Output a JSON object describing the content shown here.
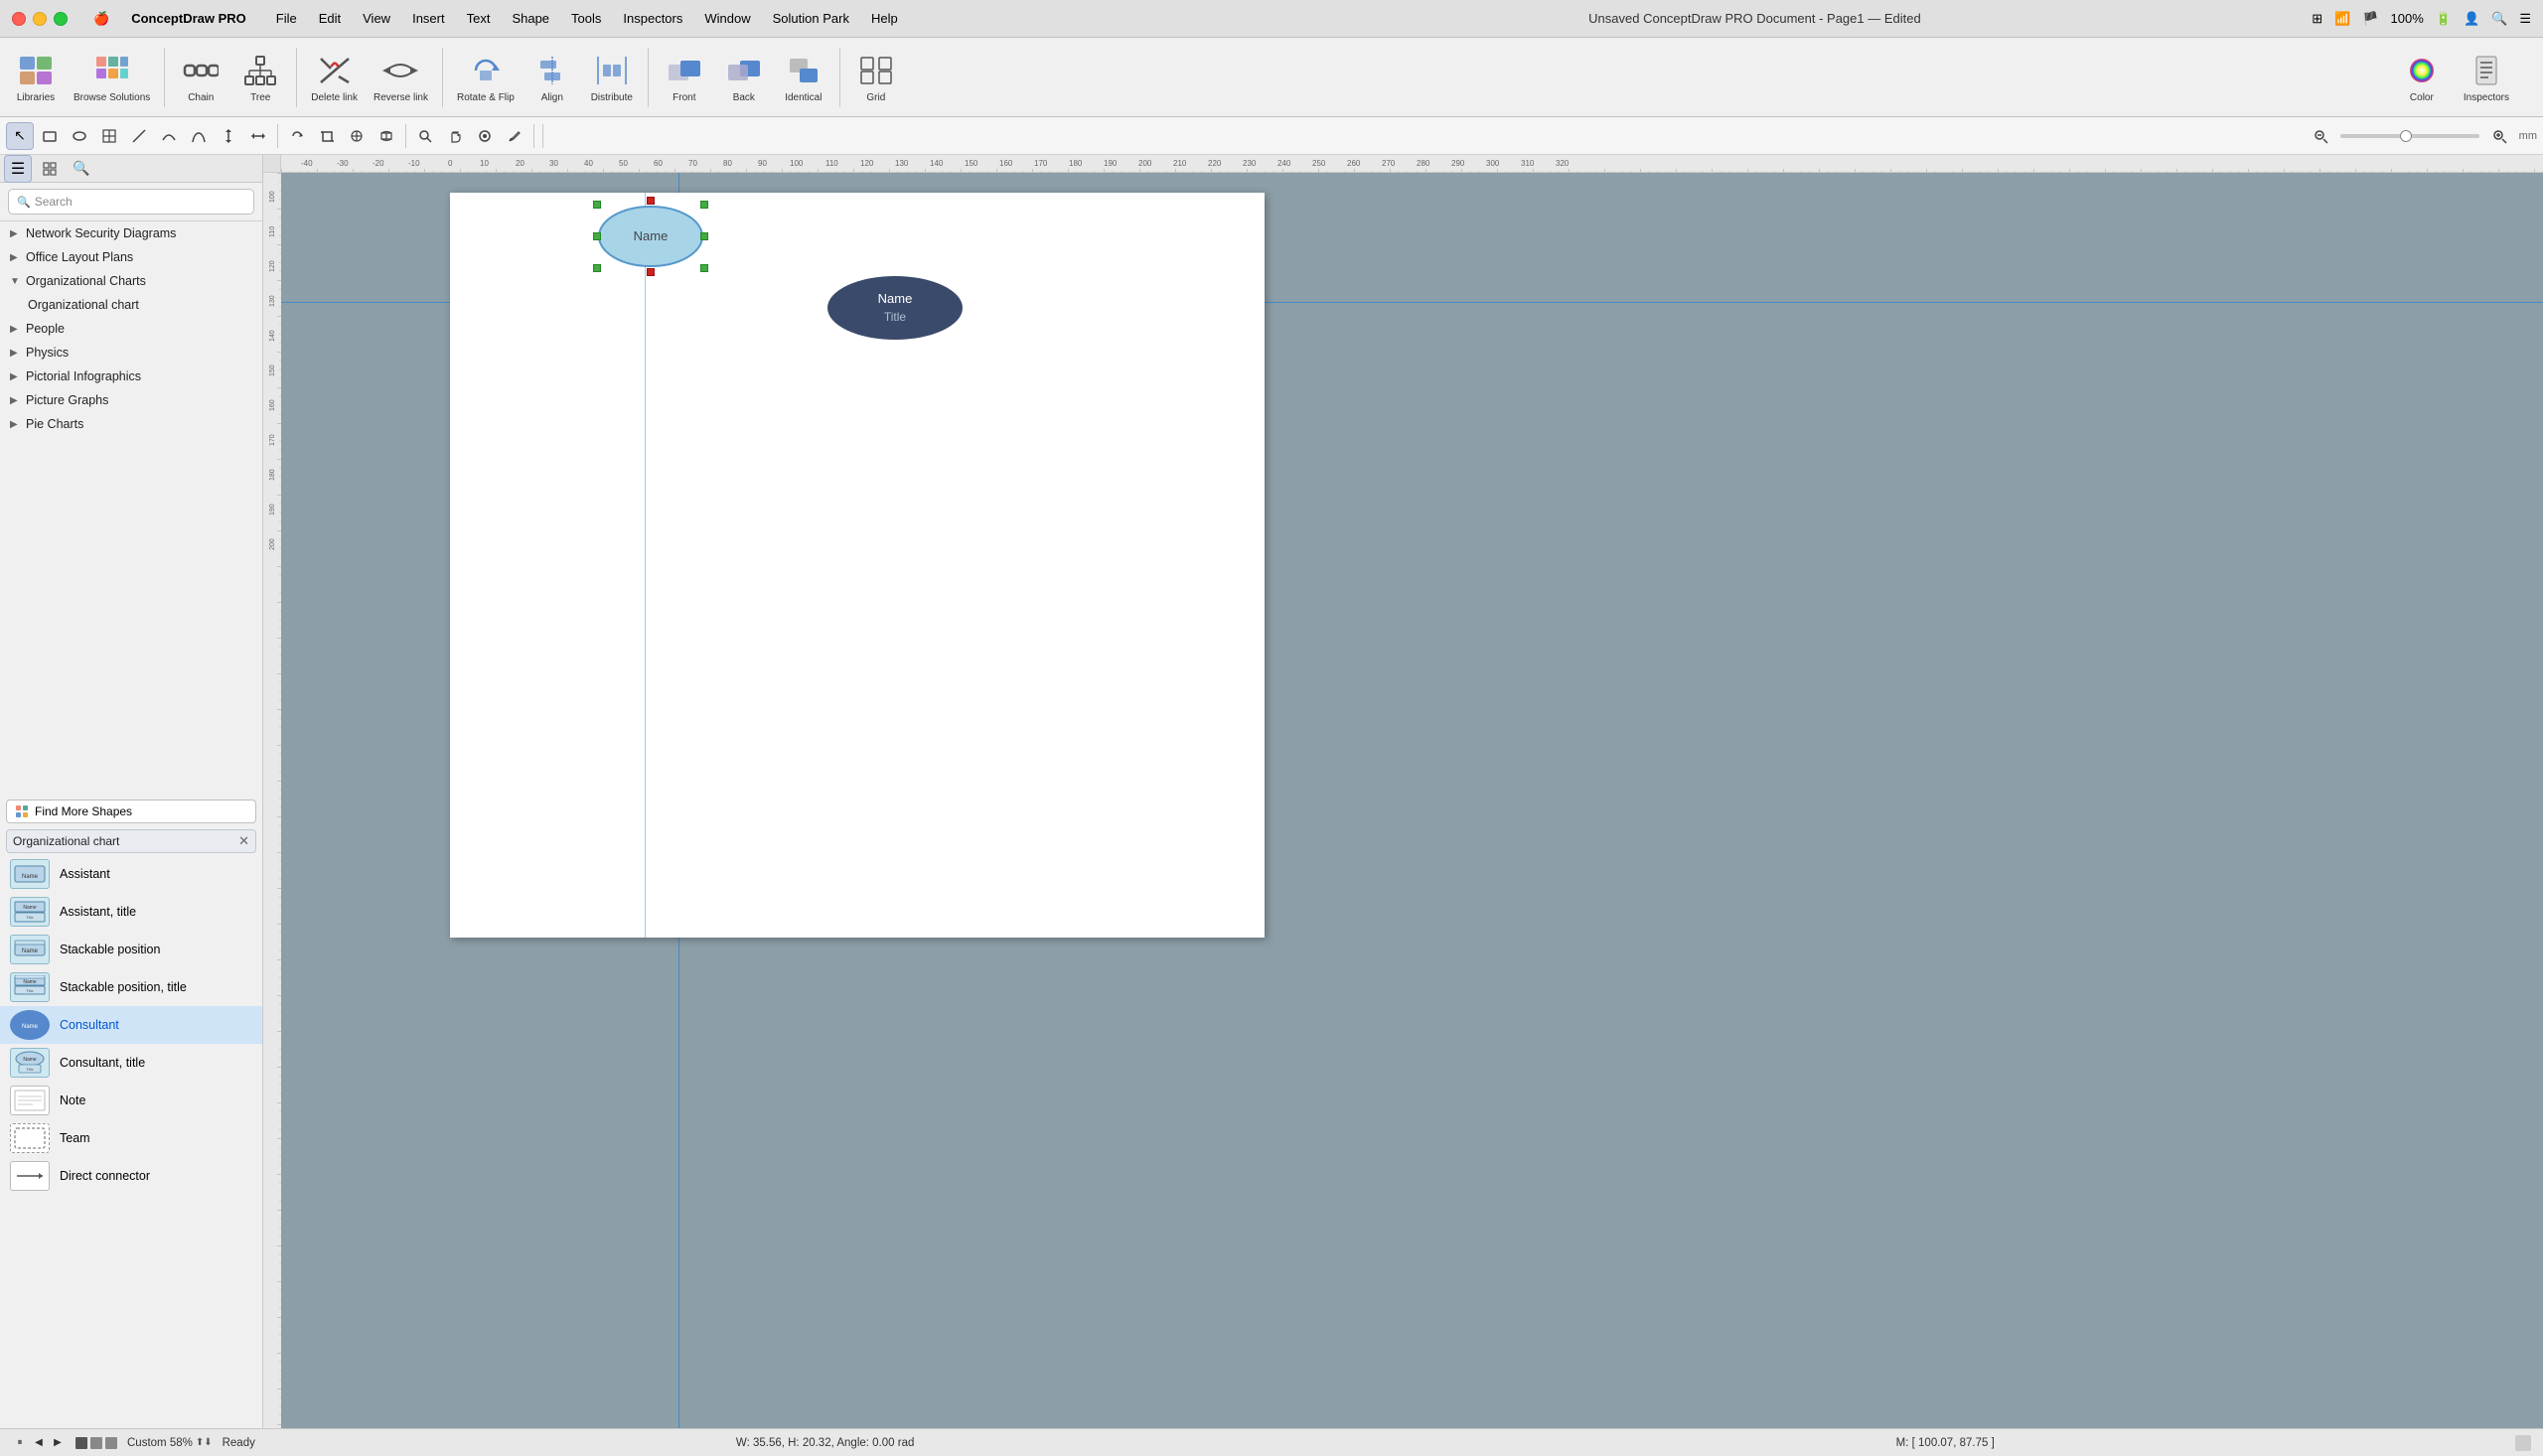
{
  "app": {
    "name": "ConceptDraw PRO",
    "title": "Unsaved ConceptDraw PRO Document - Page1 — Edited"
  },
  "menubar": {
    "apple": "⌘",
    "items": [
      "ConceptDraw PRO",
      "File",
      "Edit",
      "View",
      "Insert",
      "Text",
      "Shape",
      "Tools",
      "Inspectors",
      "Window",
      "Solution Park",
      "Help"
    ]
  },
  "system_icons": {
    "grid": "⊞",
    "wifi": "📶",
    "flag": "🏴",
    "zoom": "100%",
    "battery": "🔋",
    "user": "👤",
    "search": "🔍",
    "menu": "☰"
  },
  "toolbar": {
    "items": [
      {
        "id": "libraries",
        "label": "Libraries",
        "icon": "📚"
      },
      {
        "id": "browse-solutions",
        "label": "Browse Solutions",
        "icon": "🗂️"
      },
      {
        "id": "chain",
        "label": "Chain",
        "icon": "🔗"
      },
      {
        "id": "tree",
        "label": "Tree",
        "icon": "🌳"
      },
      {
        "id": "delete-link",
        "label": "Delete link",
        "icon": "✂"
      },
      {
        "id": "reverse-link",
        "label": "Reverse link",
        "icon": "↔"
      },
      {
        "id": "rotate-flip",
        "label": "Rotate & Flip",
        "icon": "🔄"
      },
      {
        "id": "align",
        "label": "Align",
        "icon": "⊞"
      },
      {
        "id": "distribute",
        "label": "Distribute",
        "icon": "⊟"
      },
      {
        "id": "front",
        "label": "Front",
        "icon": "▲"
      },
      {
        "id": "back",
        "label": "Back",
        "icon": "▼"
      },
      {
        "id": "identical",
        "label": "Identical",
        "icon": "⬛"
      },
      {
        "id": "grid",
        "label": "Grid",
        "icon": "⊞"
      },
      {
        "id": "color",
        "label": "Color",
        "icon": "🎨"
      },
      {
        "id": "inspectors",
        "label": "Inspectors",
        "icon": "ℹ️"
      }
    ]
  },
  "toolbar2": {
    "tools": [
      {
        "id": "select",
        "icon": "↖",
        "active": true
      },
      {
        "id": "rect",
        "icon": "▭"
      },
      {
        "id": "ellipse",
        "icon": "⬭"
      },
      {
        "id": "table",
        "icon": "⊞"
      },
      {
        "id": "line",
        "icon": "╱"
      },
      {
        "id": "curve",
        "icon": "⌒"
      },
      {
        "id": "bezier",
        "icon": "∿"
      },
      {
        "id": "resize-h",
        "icon": "↕"
      },
      {
        "id": "resize-v",
        "icon": "↔"
      },
      {
        "id": "sep1",
        "type": "sep"
      },
      {
        "id": "rotate",
        "icon": "⟲"
      },
      {
        "id": "connect",
        "icon": "⊕"
      },
      {
        "id": "sep2",
        "type": "sep"
      },
      {
        "id": "zoom-sel",
        "icon": "⬚"
      },
      {
        "id": "zoom-fit",
        "icon": "⊡"
      },
      {
        "id": "zoom-pg",
        "icon": "⊞"
      },
      {
        "id": "sep3",
        "type": "sep"
      },
      {
        "id": "zoom-glass",
        "icon": "🔍"
      },
      {
        "id": "hand",
        "icon": "✋"
      },
      {
        "id": "highlight",
        "icon": "✎"
      },
      {
        "id": "pen",
        "icon": "✒"
      }
    ],
    "zoom_label": "mm",
    "zoom_minus": "−",
    "zoom_plus": "+"
  },
  "sidebar": {
    "tabs": [
      "≡",
      "⊞",
      "🔍"
    ],
    "search_placeholder": "Search",
    "library_items": [
      {
        "id": "network-security",
        "label": "Network Security Diagrams",
        "expanded": false,
        "level": 0
      },
      {
        "id": "office-layout",
        "label": "Office Layout Plans",
        "expanded": false,
        "level": 0
      },
      {
        "id": "org-charts",
        "label": "Organizational Charts",
        "expanded": true,
        "level": 0
      },
      {
        "id": "org-chart-sub",
        "label": "Organizational chart",
        "level": 1
      },
      {
        "id": "people",
        "label": "People",
        "expanded": false,
        "level": 0
      },
      {
        "id": "physics",
        "label": "Physics",
        "expanded": false,
        "level": 0
      },
      {
        "id": "pictorial-infographics",
        "label": "Pictorial Infographics",
        "expanded": false,
        "level": 0
      },
      {
        "id": "picture-graphs",
        "label": "Picture Graphs",
        "expanded": false,
        "level": 0
      },
      {
        "id": "pie-charts",
        "label": "Pie Charts",
        "expanded": false,
        "level": 0
      }
    ],
    "find_more_shapes": "Find More Shapes",
    "active_library": "Organizational chart",
    "shapes": [
      {
        "id": "assistant",
        "label": "Assistant",
        "style": "light"
      },
      {
        "id": "assistant-title",
        "label": "Assistant, title",
        "style": "light"
      },
      {
        "id": "stackable-position",
        "label": "Stackable position",
        "style": "light"
      },
      {
        "id": "stackable-position-title",
        "label": "Stackable position, title",
        "style": "light"
      },
      {
        "id": "consultant",
        "label": "Consultant",
        "style": "circle-blue",
        "selected": true
      },
      {
        "id": "consultant-title",
        "label": "Consultant, title",
        "style": "light"
      },
      {
        "id": "note",
        "label": "Note",
        "style": "white"
      },
      {
        "id": "team",
        "label": "Team",
        "style": "dashed"
      },
      {
        "id": "direct-connector",
        "label": "Direct connector",
        "style": "connector"
      }
    ]
  },
  "canvas": {
    "selected_shape": {
      "label": "Name"
    },
    "oval_shape": {
      "name": "Name",
      "title": "Title"
    },
    "zoom_level": "Custom 58%",
    "status_ready": "Ready",
    "status_size": "W: 35.56,  H: 20.32,  Angle: 0.00 rad",
    "status_mouse": "M: [ 100.07, 87.75 ]"
  },
  "ruler": {
    "unit": "mm",
    "marks": [
      -40,
      -30,
      -20,
      -10,
      0,
      10,
      20,
      30,
      40,
      50,
      60,
      70,
      80,
      90,
      100,
      110,
      120,
      130,
      140,
      150,
      160,
      170,
      180,
      190,
      200,
      210,
      220,
      230,
      240,
      250,
      260,
      270,
      280,
      290,
      300,
      310,
      320
    ]
  }
}
